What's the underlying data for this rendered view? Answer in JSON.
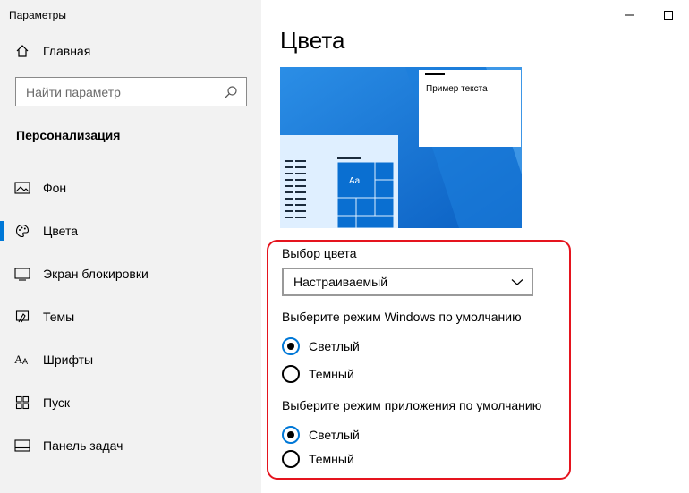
{
  "window": {
    "title": "Параметры"
  },
  "sidebar": {
    "home_label": "Главная",
    "search_placeholder": "Найти параметр",
    "section_title": "Персонализация",
    "items": [
      {
        "label": "Фон",
        "icon": "image-icon"
      },
      {
        "label": "Цвета",
        "icon": "palette-icon",
        "active": true
      },
      {
        "label": "Экран блокировки",
        "icon": "lock-screen-icon"
      },
      {
        "label": "Темы",
        "icon": "themes-icon"
      },
      {
        "label": "Шрифты",
        "icon": "fonts-icon"
      },
      {
        "label": "Пуск",
        "icon": "start-icon"
      },
      {
        "label": "Панель задач",
        "icon": "taskbar-icon"
      }
    ]
  },
  "main": {
    "title": "Цвета",
    "preview": {
      "sample_text": "Пример текста",
      "tile_label": "Aa"
    },
    "color_choice": {
      "label": "Выбор цвета",
      "selected": "Настраиваемый"
    },
    "windows_mode": {
      "label": "Выберите режим Windows по умолчанию",
      "options": [
        "Светлый",
        "Темный"
      ],
      "selected": "Светлый"
    },
    "app_mode": {
      "label": "Выберите режим приложения по умолчанию",
      "options": [
        "Светлый",
        "Темный"
      ],
      "selected": "Светлый"
    }
  },
  "colors": {
    "accent": "#0078d7",
    "highlight_border": "#e5141e",
    "sidebar_bg": "#f2f2f2"
  }
}
